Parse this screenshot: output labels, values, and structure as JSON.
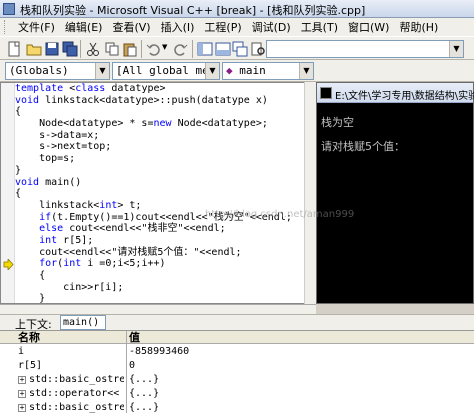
{
  "window": {
    "title": "栈和队列实验 - Microsoft Visual C++ [break] - [栈和队列实验.cpp]"
  },
  "menu": [
    "文件(F)",
    "编辑(E)",
    "查看(V)",
    "插入(I)",
    "工程(P)",
    "调试(D)",
    "工具(T)",
    "窗口(W)",
    "帮助(H)"
  ],
  "wizard": {
    "scope": "(Globals)",
    "members": "[All global members",
    "function": "main"
  },
  "code": [
    "template <class datatype>",
    "void linkstack<datatype>::push(datatype x)",
    "{",
    "    Node<datatype> * s=new Node<datatype>;",
    "    s->data=x;",
    "    s->next=top;",
    "    top=s;",
    "}",
    "void main()",
    "{",
    "    linkstack<int> t;",
    "    if(t.Empty()==1)cout<<endl<<\"栈为空\"<<endl;",
    "    else cout<<endl<<\"栈非空\"<<endl;",
    "    int r[5];",
    "    cout<<endl<<\"请对栈赋5个值：\"<<endl;",
    "    for(int i =0;i<5;i++)",
    "    {",
    "        cin>>r[i];",
    "    }"
  ],
  "console": {
    "title": "E:\\文件\\学习专用\\数据结构\\实验\\",
    "lines": [
      "栈为空",
      "请对栈赋5个值："
    ]
  },
  "watermark": "http://blog.csdn.net/aman999",
  "context": {
    "label": "上下文:",
    "value": "main()"
  },
  "variables": {
    "headers": {
      "name": "名称",
      "value": "值"
    },
    "rows": [
      {
        "name": "i",
        "value": "-858993460",
        "expandable": false
      },
      {
        "name": "r[5]",
        "value": "0",
        "expandable": false
      },
      {
        "name": "std::basic_ostrea",
        "value": "{...}",
        "expandable": true
      },
      {
        "name": "std::operator<< r",
        "value": "{...}",
        "expandable": true
      },
      {
        "name": "std::basic_ostrea",
        "value": "{...}",
        "expandable": true
      }
    ]
  },
  "colors": {
    "keyword": "#0000ff",
    "console_bg": "#000000",
    "console_text": "#c0c0c0",
    "arrow": "#f4d800"
  }
}
